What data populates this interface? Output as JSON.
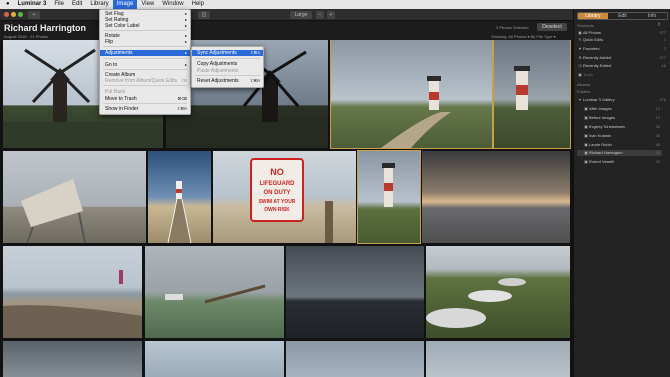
{
  "menubar": {
    "apple": "",
    "items": [
      "Luminar 3",
      "File",
      "Edit",
      "Library",
      "Image",
      "View",
      "Window",
      "Help"
    ]
  },
  "toolbar": {
    "zoom_label": "Large",
    "zoom_minus": "−",
    "zoom_plus": "+"
  },
  "header": {
    "title": "Richard Harrington",
    "subtitle": "August 2018  ·  21 Photos",
    "selected_count": "3 Photos Selected",
    "deselect_label": "Deselect",
    "showing": "Showing: All Photos ▾    By File Type ▾"
  },
  "image_menu": {
    "items": [
      {
        "label": "Set Flag",
        "shortcut": "▸",
        "state": "normal"
      },
      {
        "label": "Set Rating",
        "shortcut": "▸",
        "state": "normal"
      },
      {
        "label": "Set Color Label",
        "shortcut": "▸",
        "state": "normal"
      },
      {
        "label": "Rotate",
        "shortcut": "▸",
        "state": "normal"
      },
      {
        "label": "Flip",
        "shortcut": "▸",
        "state": "normal"
      },
      {
        "label": "Adjustments",
        "shortcut": "▸",
        "state": "highlighted"
      },
      {
        "label": "Go to",
        "shortcut": "▸",
        "state": "normal"
      },
      {
        "label": "Create Album",
        "shortcut": "",
        "state": "normal"
      },
      {
        "label": "Remove from Album/Quick Edits",
        "shortcut": "⌫",
        "state": "disabled"
      },
      {
        "label": "Put Back",
        "shortcut": "",
        "state": "disabled"
      },
      {
        "label": "Move to Trash",
        "shortcut": "⌘⌫",
        "state": "normal"
      },
      {
        "label": "Show in Finder",
        "shortcut": "⇧⌘R",
        "state": "normal"
      }
    ]
  },
  "adjustments_submenu": {
    "items": [
      {
        "label": "Sync Adjustments",
        "shortcut": "⇧⌘S",
        "state": "highlighted"
      },
      {
        "label": "Copy Adjustments",
        "shortcut": "",
        "state": "normal"
      },
      {
        "label": "Paste Adjustments",
        "shortcut": "",
        "state": "disabled"
      },
      {
        "label": "Reset Adjustments",
        "shortcut": "⇧⌘R",
        "state": "normal"
      }
    ]
  },
  "sidebar": {
    "tabs": [
      "Library",
      "Edit",
      "Info"
    ],
    "shortcuts_label": "Shortcuts",
    "shortcuts": [
      {
        "label": "All Photos",
        "count": "377",
        "icon": "photos-icon"
      },
      {
        "label": "Quick Edits",
        "count": "1",
        "icon": "quick-edit-icon"
      },
      {
        "label": "Favorites",
        "count": "2",
        "icon": "heart-icon"
      },
      {
        "label": "Recently Added",
        "count": "377",
        "icon": "plus-circle-icon"
      },
      {
        "label": "Recently Edited",
        "count": "16",
        "icon": "clock-icon"
      },
      {
        "label": "Trash",
        "count": "",
        "icon": "trash-icon"
      }
    ],
    "albums_label": "Albums",
    "folders_label": "Folders",
    "folders": [
      {
        "label": "Luminar 3 Gallery",
        "count": "376",
        "level": 0
      },
      {
        "label": "After Images",
        "count": "12",
        "level": 1
      },
      {
        "label": "Before Images",
        "count": "12",
        "level": 1
      },
      {
        "label": "Evgeny Tchebotarev",
        "count": "36",
        "level": 1
      },
      {
        "label": "Ivan Kutanin",
        "count": "36",
        "level": 1
      },
      {
        "label": "Laurie Rubin",
        "count": "48",
        "level": 1
      },
      {
        "label": "Richard Harrington",
        "count": "21",
        "level": 1
      },
      {
        "label": "Robert Vanelli",
        "count": "45",
        "level": 1
      }
    ]
  },
  "sign_text": "NO LIFEGUARD ON DUTY SWIM AT YOUR OWN RISK",
  "colors": {
    "accent": "#c98a3a",
    "menu_highlight": "#2a6ad8",
    "selection_border": "#c9a04a"
  }
}
